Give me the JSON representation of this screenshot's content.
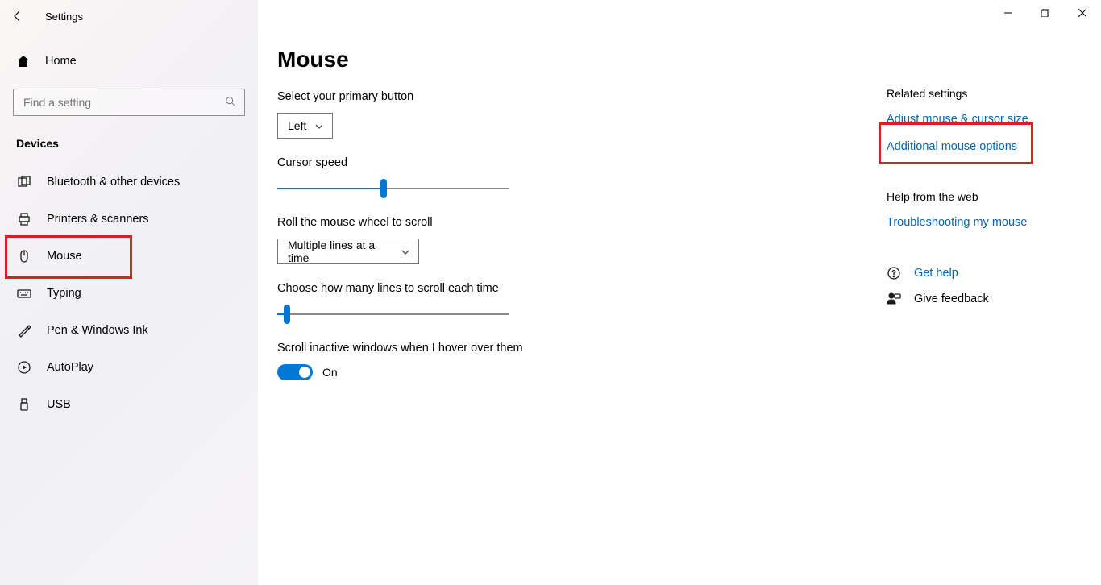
{
  "titlebar": {
    "title": "Settings"
  },
  "sidebar": {
    "home_label": "Home",
    "search_placeholder": "Find a setting",
    "section": "Devices",
    "items": [
      {
        "label": "Bluetooth & other devices"
      },
      {
        "label": "Printers & scanners"
      },
      {
        "label": "Mouse"
      },
      {
        "label": "Typing"
      },
      {
        "label": "Pen & Windows Ink"
      },
      {
        "label": "AutoPlay"
      },
      {
        "label": "USB"
      }
    ]
  },
  "page": {
    "title": "Mouse",
    "primary_button_label": "Select your primary button",
    "primary_button_value": "Left",
    "cursor_speed_label": "Cursor speed",
    "cursor_speed_percent": 46,
    "wheel_scroll_label": "Roll the mouse wheel to scroll",
    "wheel_scroll_value": "Multiple lines at a time",
    "lines_scroll_label": "Choose how many lines to scroll each time",
    "lines_scroll_percent": 4,
    "inactive_label": "Scroll inactive windows when I hover over them",
    "inactive_state": "On"
  },
  "rail": {
    "related_title": "Related settings",
    "adjust_link": "Adjust mouse & cursor size",
    "additional_link": "Additional mouse options",
    "help_title": "Help from the web",
    "troubleshoot_link": "Troubleshooting my mouse",
    "get_help": "Get help",
    "give_feedback": "Give feedback"
  }
}
